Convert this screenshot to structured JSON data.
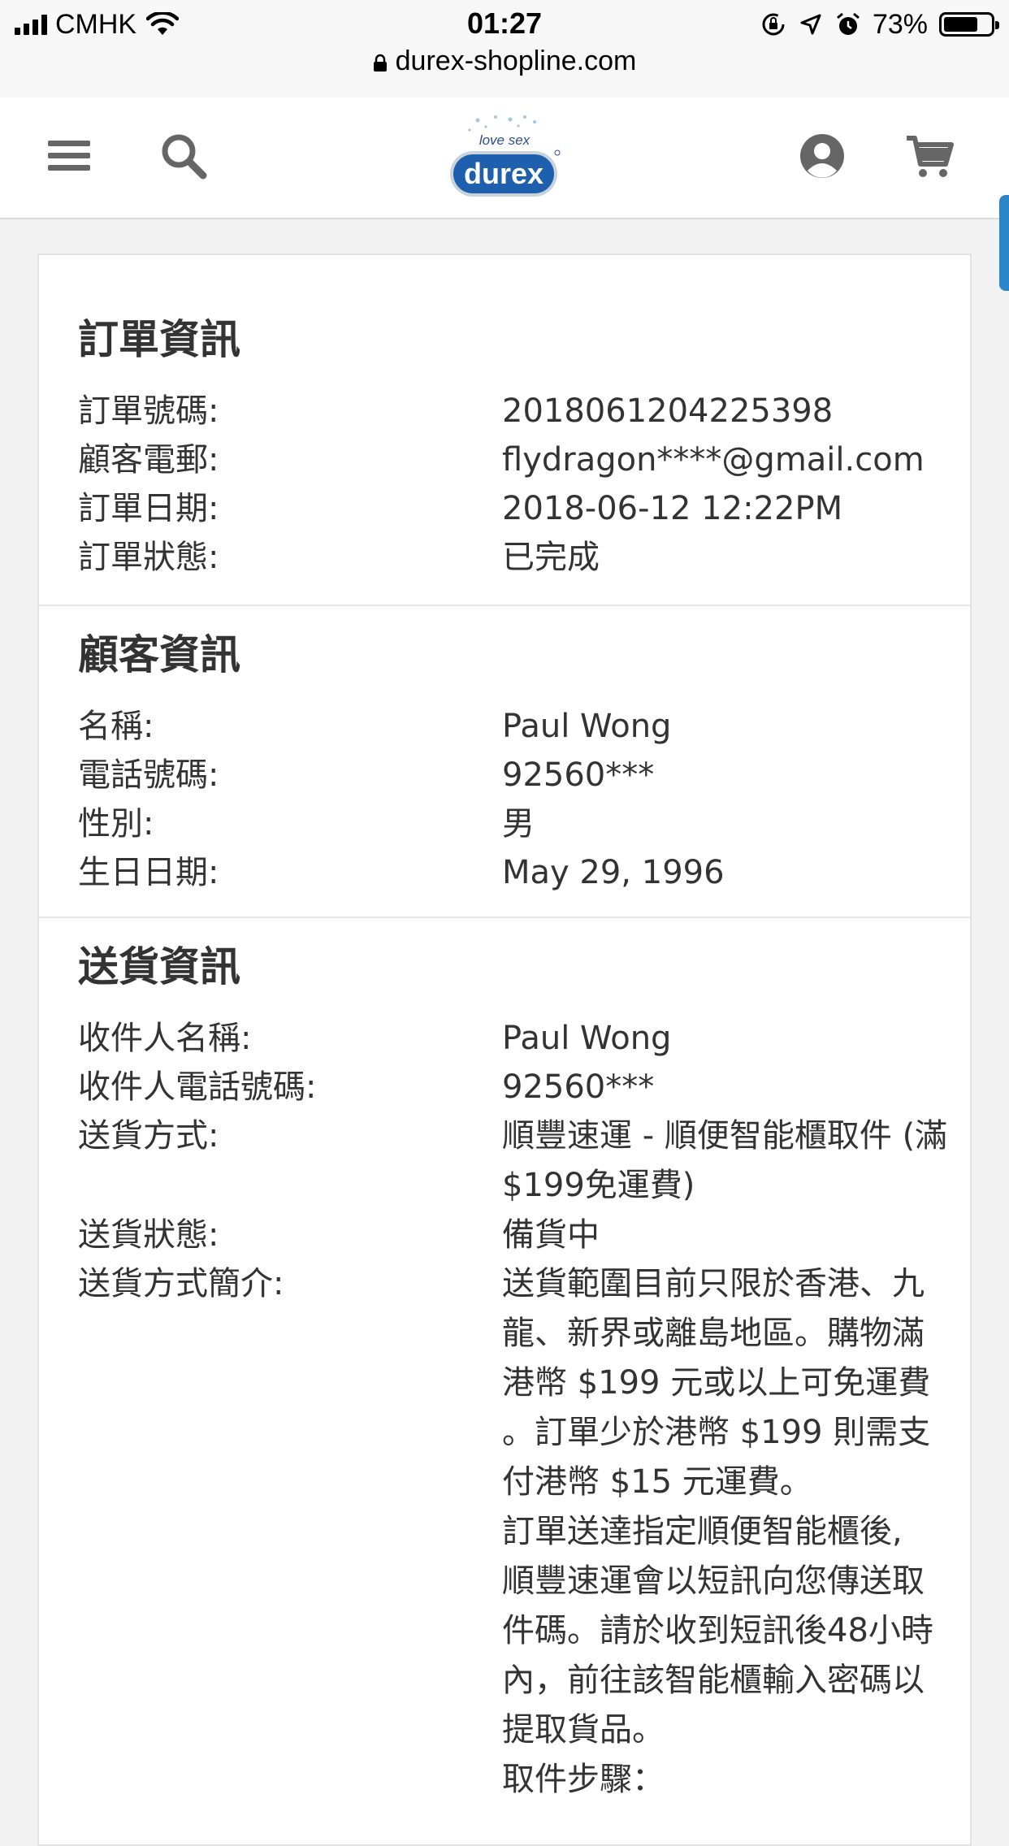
{
  "status_bar": {
    "carrier": "CMHK",
    "time": "01:27",
    "battery": "73%",
    "battery_level": 0.73,
    "url": "durex-shopline.com"
  },
  "header": {
    "logo_tagline": "love sex",
    "logo_brand": "durex",
    "icons": [
      "menu-icon",
      "search-icon",
      "account-icon",
      "cart-icon"
    ]
  },
  "order_info": {
    "title": "訂單資訊",
    "rows": [
      {
        "label": "訂單號碼:",
        "value": "2018061204225398"
      },
      {
        "label": "顧客電郵:",
        "value": "flydragon****@gmail.com"
      },
      {
        "label": "訂單日期:",
        "value": "2018-06-12 12:22PM"
      },
      {
        "label": "訂單狀態:",
        "value": "已完成"
      }
    ]
  },
  "customer_info": {
    "title": "顧客資訊",
    "rows": [
      {
        "label": "名稱:",
        "value": "Paul Wong"
      },
      {
        "label": "電話號碼:",
        "value": "92560***"
      },
      {
        "label": "性別:",
        "value": "男"
      },
      {
        "label": "生日日期:",
        "value": "May 29, 1996"
      }
    ]
  },
  "delivery_info": {
    "title": "送貨資訊",
    "recipient_name": {
      "label": "收件人名稱:",
      "value": "Paul Wong"
    },
    "recipient_phone": {
      "label": "收件人電話號碼:",
      "value": "92560***"
    },
    "method": {
      "label": "送貨方式:",
      "lines": [
        "順豐速運 - 順便智能櫃取件 (滿",
        "$199免運費)"
      ]
    },
    "status": {
      "label": "送貨狀態:",
      "value": "備貨中"
    },
    "description": {
      "label": "送貨方式簡介:",
      "lines": [
        "送貨範圍目前只限於香港、九",
        "龍、新界或離島地區。購物滿",
        "港幣 $199 元或以上可免運費",
        "。訂單少於港幣 $199 則需支",
        "付港幣 $15 元運費。",
        "訂單送達指定順便智能櫃後,",
        "順豐速運會以短訊向您傳送取",
        "件碼。請於收到短訊後48小時",
        "內，前往該智能櫃輸入密碼以",
        "提取貨品。",
        "取件步驟："
      ]
    }
  }
}
